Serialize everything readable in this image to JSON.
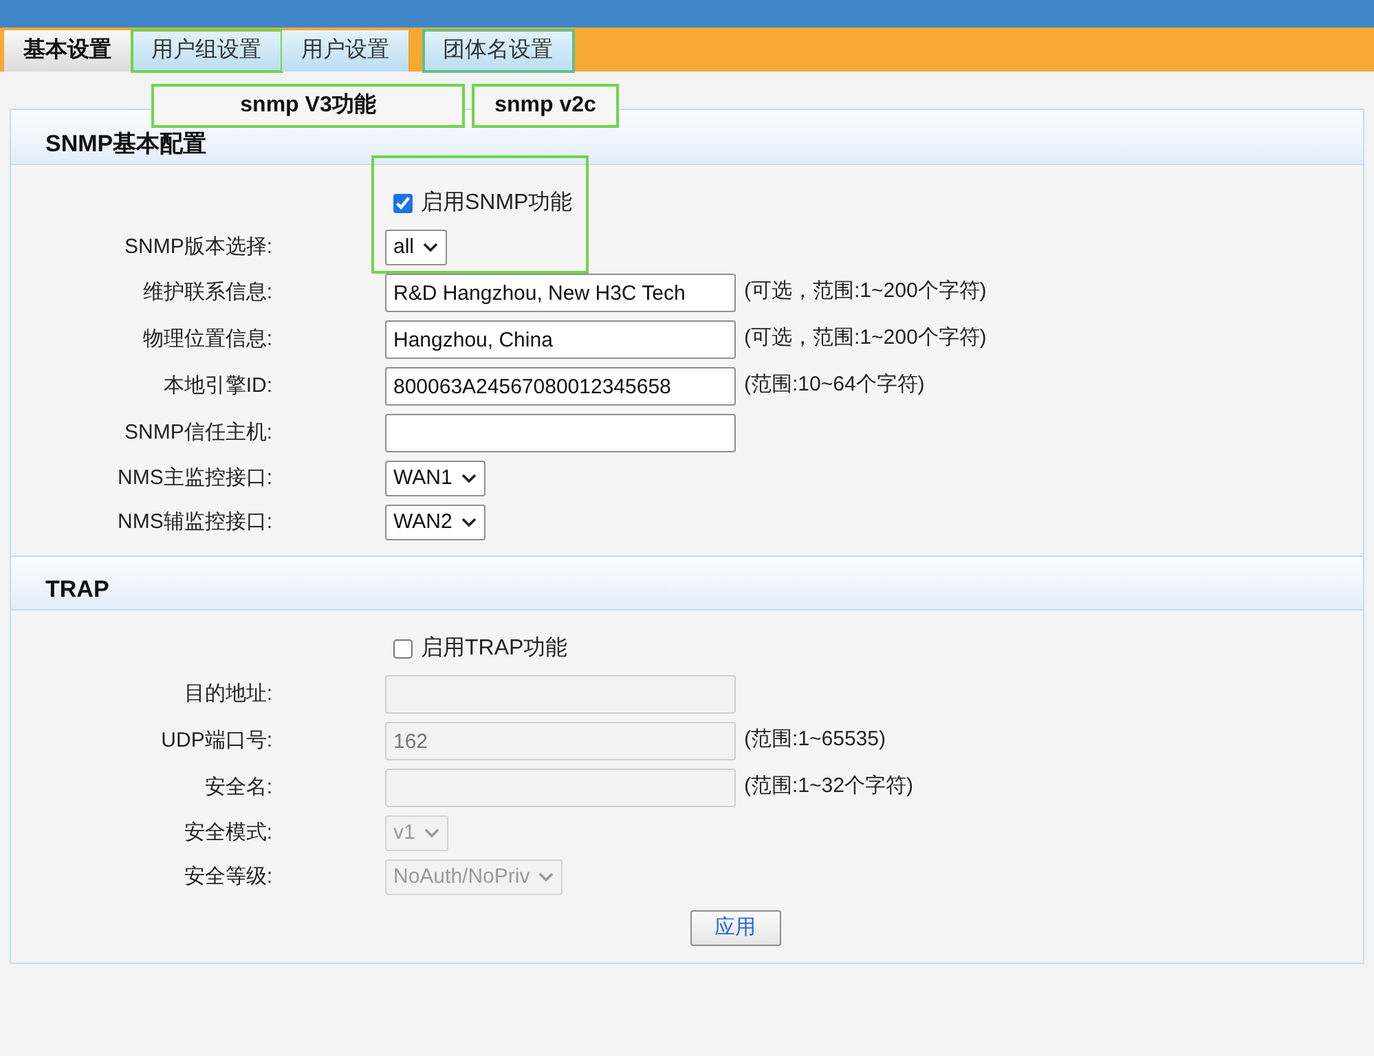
{
  "tabs": [
    {
      "label": "基本设置",
      "selected": true
    },
    {
      "label": "用户组设置",
      "selected": false
    },
    {
      "label": "用户设置",
      "selected": false
    },
    {
      "label": "团体名设置",
      "selected": false
    }
  ],
  "annotations": [
    {
      "label": "snmp V3功能"
    },
    {
      "label": "snmp v2c"
    }
  ],
  "sections": [
    {
      "title": "SNMP基本配置",
      "enable": {
        "label": "启用SNMP功能",
        "checked": true
      },
      "rows": [
        {
          "kind": "select",
          "label": "SNMP版本选择:",
          "value": "all",
          "disabled": false
        },
        {
          "kind": "text",
          "label": "维护联系信息:",
          "value": "R&D Hangzhou, New H3C Tech",
          "hint": "(可选，范围:1~200个字符)",
          "disabled": false
        },
        {
          "kind": "text",
          "label": "物理位置信息:",
          "value": "Hangzhou, China",
          "hint": "(可选，范围:1~200个字符)",
          "disabled": false
        },
        {
          "kind": "text",
          "label": "本地引擎ID:",
          "value": "800063A24567080012345658",
          "hint": "(范围:10~64个字符)",
          "disabled": false
        },
        {
          "kind": "text",
          "label": "SNMP信任主机:",
          "disabled": false
        },
        {
          "kind": "select",
          "label": "NMS主监控接口:",
          "value": "WAN1",
          "disabled": false
        },
        {
          "kind": "select",
          "label": "NMS辅监控接口:",
          "value": "WAN2",
          "disabled": false
        }
      ]
    },
    {
      "title": "TRAP",
      "enable": {
        "label": "启用TRAP功能",
        "checked": false
      },
      "rows": [
        {
          "kind": "text",
          "label": "目的地址:",
          "disabled": true
        },
        {
          "kind": "text",
          "label": "UDP端口号:",
          "value": "162",
          "hint": "(范围:1~65535)",
          "disabled": true
        },
        {
          "kind": "text",
          "label": "安全名:",
          "hint": "(范围:1~32个字符)",
          "disabled": true
        },
        {
          "kind": "select",
          "label": "安全模式:",
          "value": "v1",
          "disabled": true
        },
        {
          "kind": "select",
          "label": "安全等级:",
          "value": "NoAuth/NoPriv",
          "disabled": true
        }
      ]
    }
  ],
  "apply_button": "应用"
}
